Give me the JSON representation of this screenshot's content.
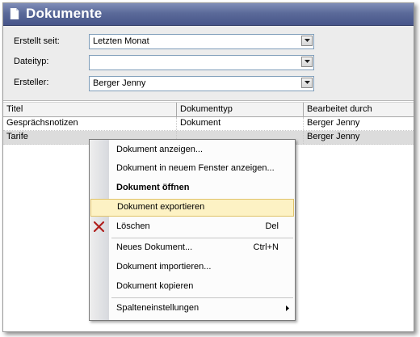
{
  "window": {
    "title": "Dokumente"
  },
  "filters": {
    "created_since": {
      "label": "Erstellt seit:",
      "value": "Letzten Monat"
    },
    "file_type": {
      "label": "Dateityp:",
      "value": ""
    },
    "creator": {
      "label": "Ersteller:",
      "value": "Berger Jenny"
    }
  },
  "grid": {
    "columns": [
      "Titel",
      "Dokumenttyp",
      "Bearbeitet durch"
    ],
    "rows": [
      [
        "Gesprächsnotizen",
        "Dokument",
        "Berger Jenny"
      ],
      [
        "Tarife",
        "",
        "Berger Jenny"
      ]
    ]
  },
  "context_menu": {
    "items": [
      {
        "label": "Dokument anzeigen...",
        "shortcut": ""
      },
      {
        "label": "Dokument in neuem Fenster anzeigen...",
        "shortcut": ""
      },
      {
        "label": "Dokument öffnen",
        "shortcut": ""
      },
      {
        "label": "Dokument exportieren",
        "shortcut": ""
      },
      {
        "label": "Löschen",
        "shortcut": "Del"
      },
      {
        "label": "Neues Dokument...",
        "shortcut": "Ctrl+N"
      },
      {
        "label": "Dokument importieren...",
        "shortcut": ""
      },
      {
        "label": "Dokument kopieren",
        "shortcut": ""
      },
      {
        "label": "Spalteneinstellungen",
        "shortcut": ""
      }
    ]
  },
  "colors": {
    "titlebar": "#5b6a99",
    "highlight": "#fdf2c4",
    "delete_icon": "#b0201e"
  }
}
